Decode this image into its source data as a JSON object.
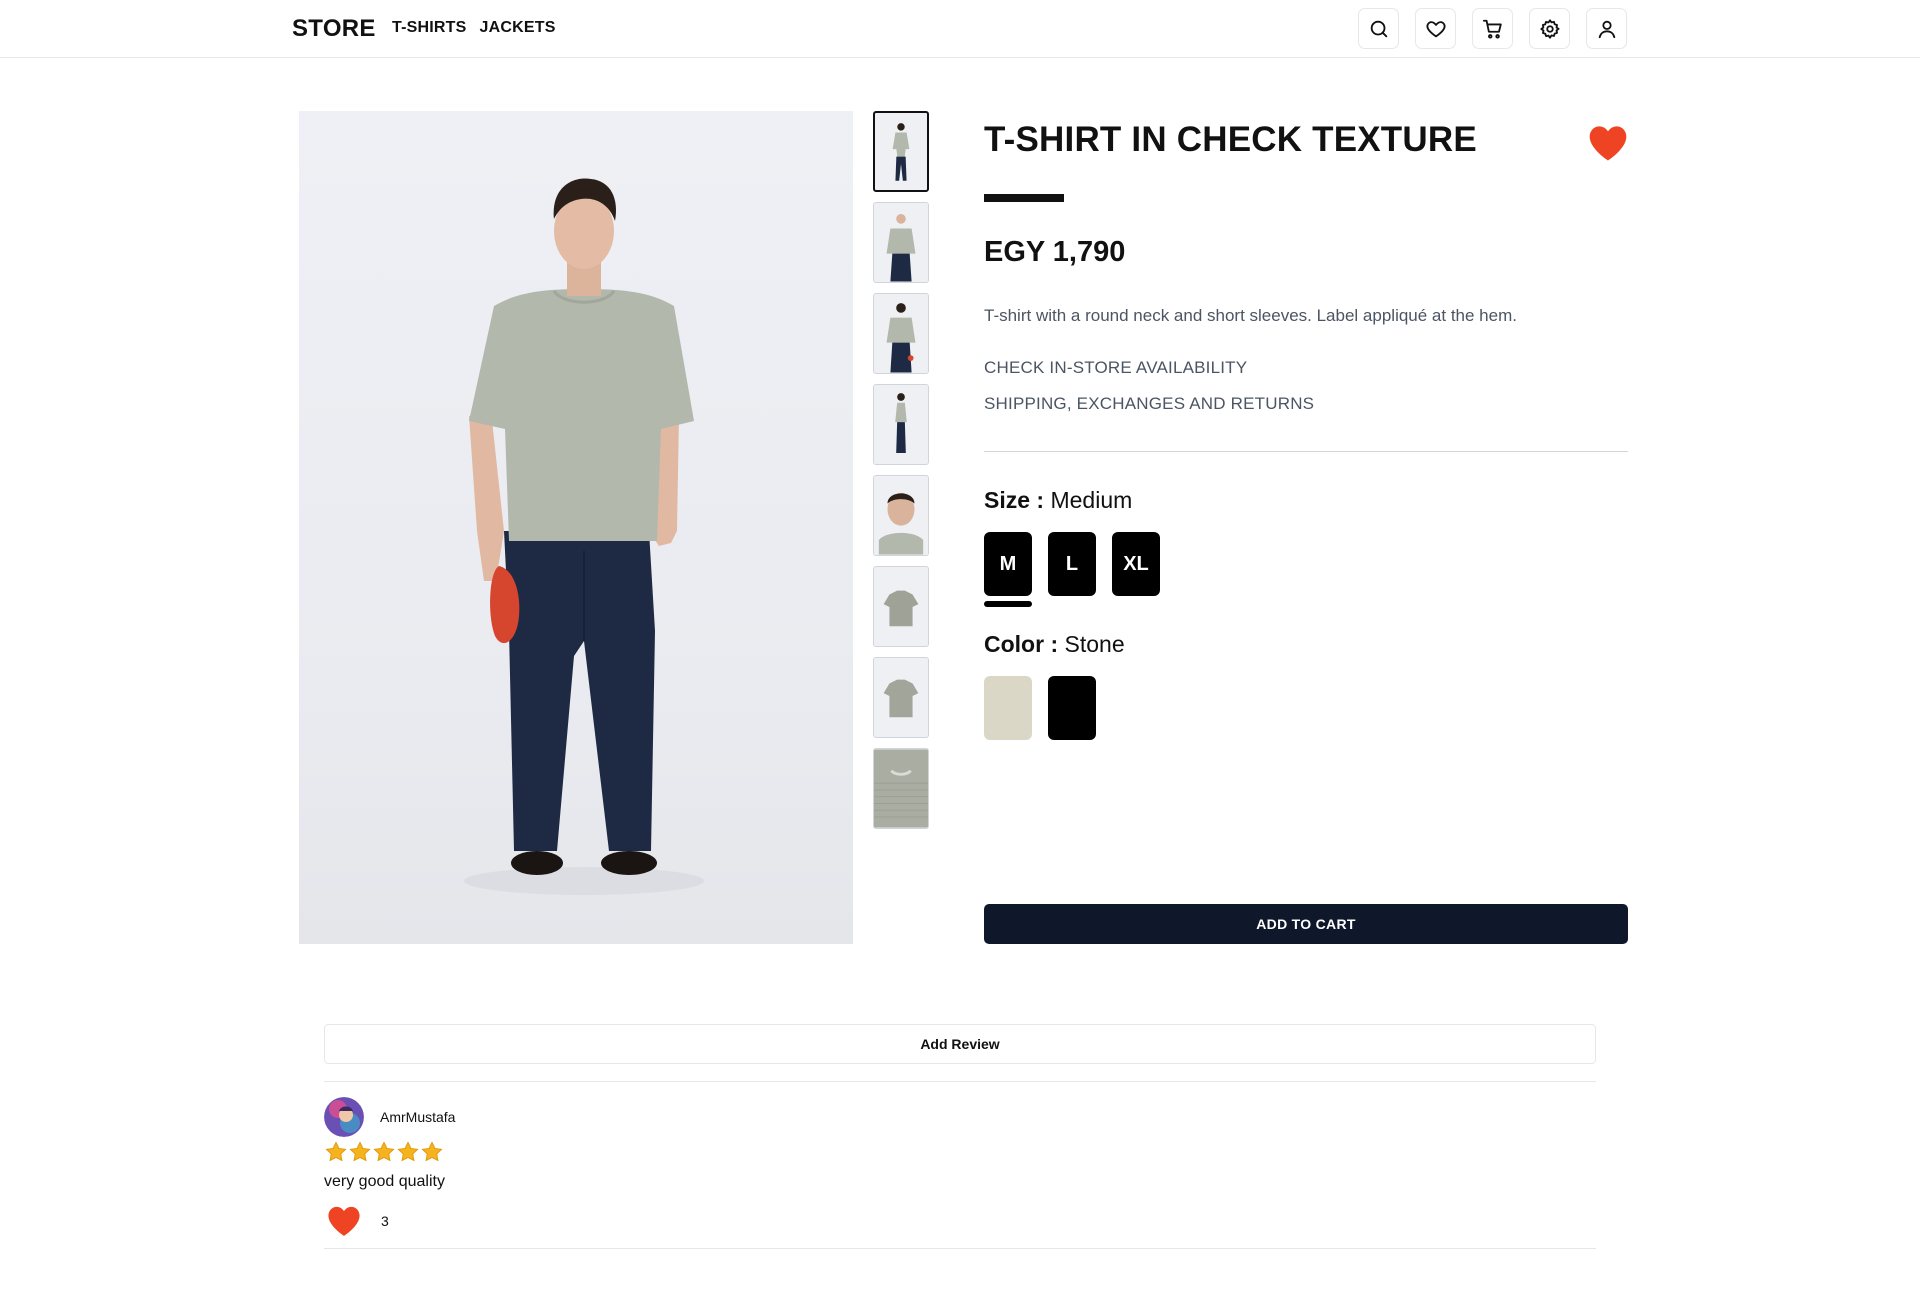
{
  "header": {
    "brand": "STORE",
    "nav": [
      "T-SHIRTS",
      "JACKETS"
    ],
    "icons": [
      "search-icon",
      "heart-icon",
      "cart-icon",
      "gear-icon",
      "user-icon"
    ]
  },
  "gallery": {
    "thumbnail_count": 8,
    "active_index": 0
  },
  "product": {
    "title": "T-SHIRT IN CHECK TEXTURE",
    "price": "EGY 1,790",
    "description": "T-shirt with a round neck and short sleeves. Label appliqué at the hem.",
    "links": [
      "CHECK IN-STORE AVAILABILITY",
      "SHIPPING, EXCHANGES AND RETURNS"
    ],
    "size_label": "Size :",
    "selected_size": "Medium",
    "sizes": [
      "M",
      "L",
      "XL"
    ],
    "color_label": "Color :",
    "selected_color": "Stone",
    "colors": [
      "#dbd7c7",
      "#000000"
    ],
    "add_to_cart": "ADD TO CART",
    "favorite_color": "#ef4423"
  },
  "reviews": {
    "add_review": "Add Review",
    "items": [
      {
        "user": "AmrMustafa",
        "rating": 5,
        "comment": "very good quality",
        "likes": "3"
      }
    ]
  }
}
